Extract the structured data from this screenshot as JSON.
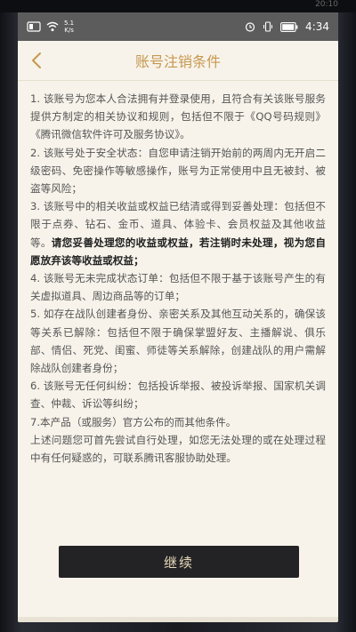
{
  "status_bar": {
    "carrier": "5.1\nK/s",
    "net_top": "5.1",
    "net_bottom": "K/s",
    "time": "4:34",
    "top_time": "20:10"
  },
  "header": {
    "title": "账号注销条件",
    "back_icon": "chevron-left-icon"
  },
  "terms": [
    {
      "text": "1. 该账号为您本人合法拥有并登录使用，且符合有关该账号服务提供方制定的相关协议和规则，包括但不限于《QQ号码规则》《腾讯微信软件许可及服务协议》。"
    },
    {
      "text": "2. 该账号处于安全状态：自您申请注销开始前的两周内无开启二级密码、免密操作等敏感操作，账号为正常使用中且无被封、被盗等风险；"
    },
    {
      "text": "3. 该账号中的相关收益或权益已结清或得到妥善处理：包括但不限于点券、钻石、金币、道具、体验卡、会员权益及其他收益等。",
      "bold": "请您妥善处理您的收益或权益，若注销时未处理，视为您自愿放弃该等收益或权益；"
    },
    {
      "text": "4. 该账号无未完成状态订单：包括但不限于基于该账号产生的有关虚拟道具、周边商品等的订单；"
    },
    {
      "text": "5. 如存在战队创建者身份、亲密关系及其他互动关系的，确保该等关系已解除：包括但不限于确保掌盟好友、主播解说、俱乐部、情侣、死党、闺蜜、师徒等关系解除，创建战队的用户需解除战队创建者身份；"
    },
    {
      "text": "6. 该账号无任何纠纷：包括投诉举报、被投诉举报、国家机关调查、仲裁、诉讼等纠纷；"
    },
    {
      "text": "7.本产品（或服务）官方公布的而其他条件。"
    },
    {
      "text": "上述问题您可首先尝试自行处理，如您无法处理的或在处理过程中有任何疑惑的，可联系腾讯客服协助处理。"
    }
  ],
  "continue_button": {
    "label": "继续"
  }
}
